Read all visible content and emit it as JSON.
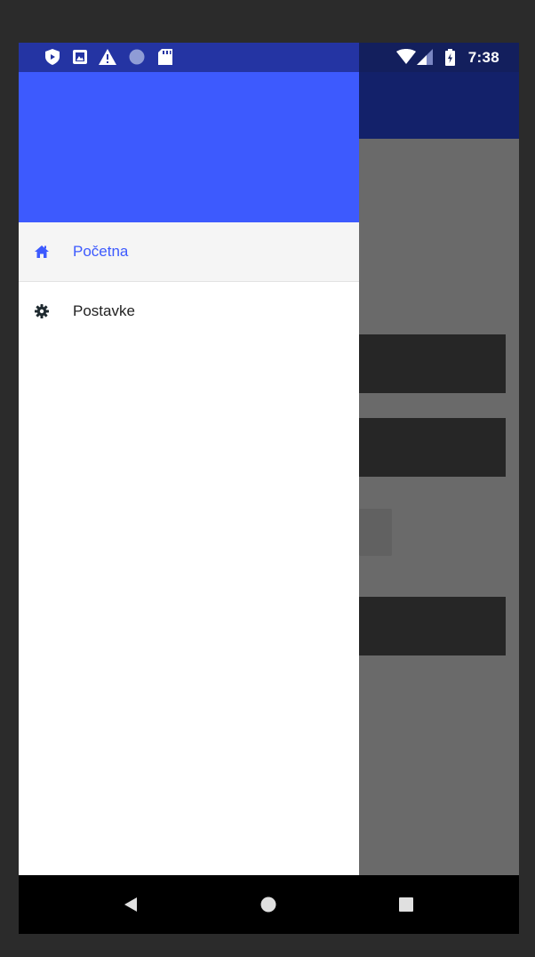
{
  "status_bar": {
    "time": "7:38",
    "left_icons": [
      "shield-icon",
      "image-icon",
      "warning-icon",
      "circle-icon",
      "sd-card-icon"
    ],
    "right_icons": [
      "wifi-icon",
      "signal-icon",
      "battery-icon"
    ]
  },
  "drawer": {
    "header_color": "#3d5afe",
    "items": [
      {
        "label": "Početna",
        "icon": "home-icon",
        "active": true
      },
      {
        "label": "Postavke",
        "icon": "gear-icon",
        "active": false
      }
    ]
  },
  "nav_bar": {
    "buttons": [
      "back-icon",
      "home-circle-icon",
      "recents-icon"
    ]
  },
  "colors": {
    "accent": "#3d5afe",
    "status_bar": "#2434a3",
    "toolbar_dimmed": "#13216a",
    "text_primary": "#212121"
  }
}
